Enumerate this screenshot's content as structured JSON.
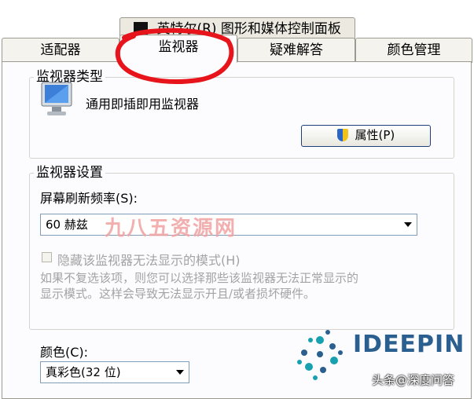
{
  "window": {
    "title": "英特尔(R) 图形和媒体控制面板"
  },
  "tabs": [
    {
      "label": "适配器"
    },
    {
      "label": "监视器"
    },
    {
      "label": "疑难解答"
    },
    {
      "label": "颜色管理"
    }
  ],
  "monitor_type": {
    "group_label": "监视器类型",
    "device_name": "通用即插即用监视器",
    "properties_button": "属性(P)"
  },
  "monitor_settings": {
    "group_label": "监视器设置",
    "refresh_label": "屏幕刷新频率(S):",
    "refresh_value": "60 赫兹",
    "hide_modes_label": "隐藏该监视器无法显示的模式(H)",
    "hide_modes_checked": false,
    "hint_line1": "如果不复选该项，则您可以选择那些该监视器无法正常显示的",
    "hint_line2": "显示模式。这样会导致无法显示开且/或者损坏硬件。"
  },
  "colors": {
    "label": "颜色(C):",
    "value": "真彩色(32 位)"
  },
  "watermarks": {
    "red_text": "九八五资源网",
    "brand": "IDEEPIN",
    "caption": "头条@深度问答"
  },
  "colors_theme": {
    "annotation_red": "#e8141c",
    "watermark_red": "#f2a0a0",
    "logo_blue": "#2a5f8f",
    "logo_teal": "#17a0b0"
  }
}
